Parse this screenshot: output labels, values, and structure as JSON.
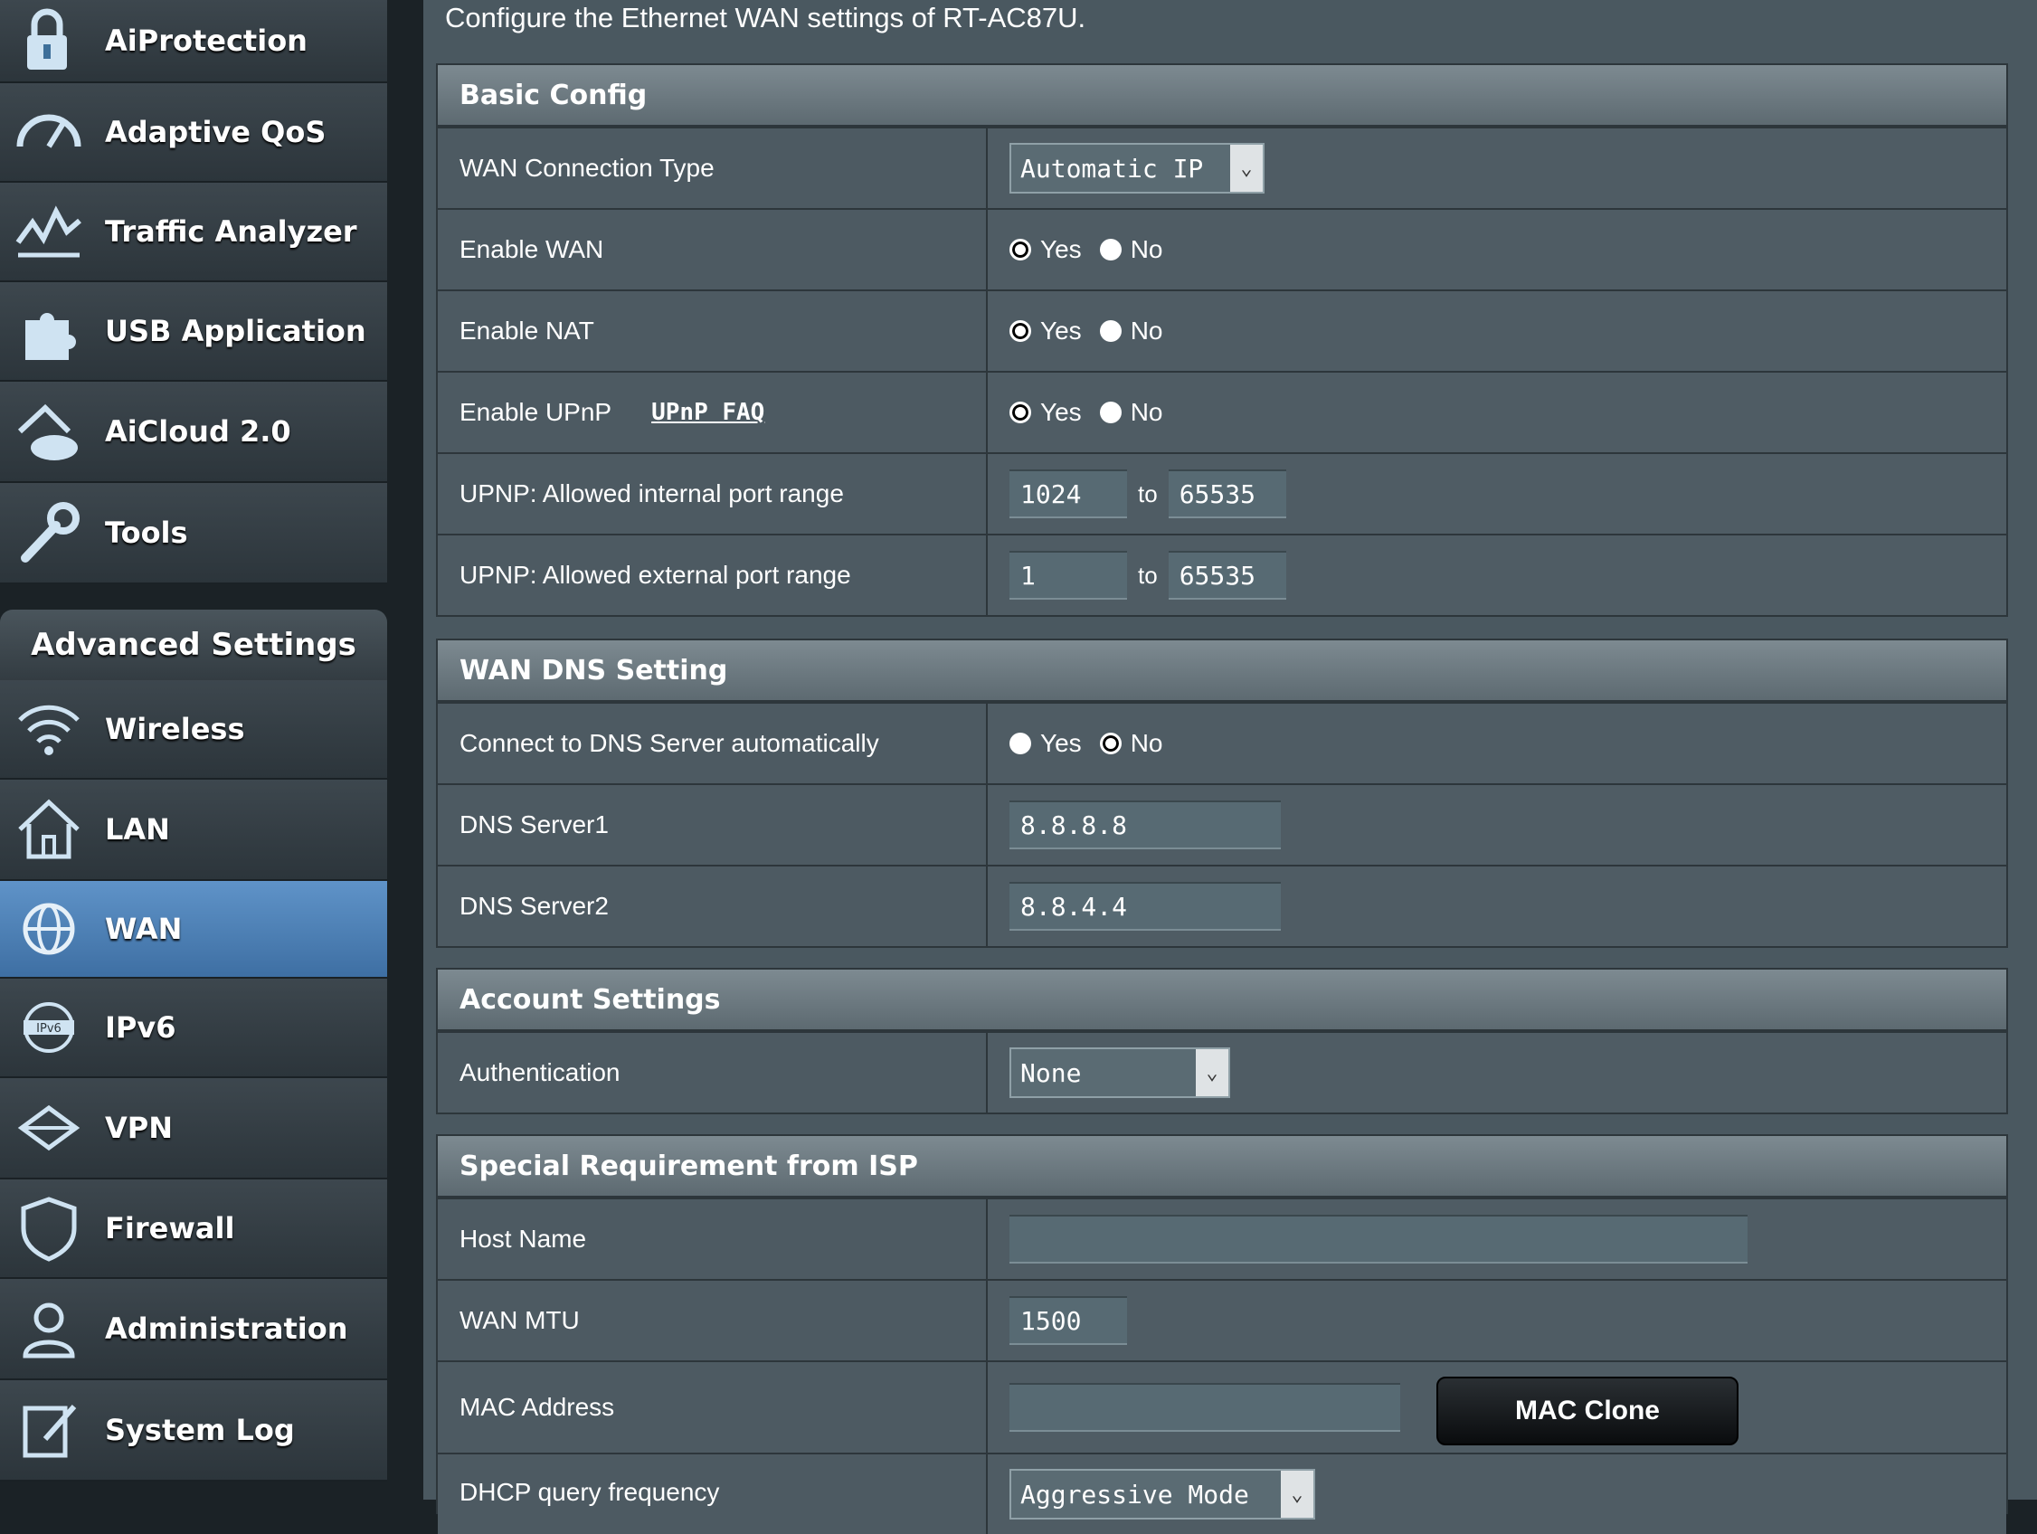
{
  "sidebar": {
    "general_items": [
      {
        "label": "AiProtection",
        "icon": "lock-icon"
      },
      {
        "label": "Adaptive QoS",
        "icon": "speedometer-icon"
      },
      {
        "label": "Traffic Analyzer",
        "icon": "activity-chart-icon"
      },
      {
        "label": "USB Application",
        "icon": "puzzle-icon"
      },
      {
        "label": "AiCloud 2.0",
        "icon": "cloud-house-icon"
      },
      {
        "label": "Tools",
        "icon": "wrench-icon"
      }
    ],
    "advanced_header": "Advanced Settings",
    "advanced_items": [
      {
        "label": "Wireless",
        "icon": "wifi-icon"
      },
      {
        "label": "LAN",
        "icon": "house-icon"
      },
      {
        "label": "WAN",
        "icon": "globe-icon",
        "selected": true
      },
      {
        "label": "IPv6",
        "icon": "ipv6-globe-icon"
      },
      {
        "label": "VPN",
        "icon": "vpn-icon"
      },
      {
        "label": "Firewall",
        "icon": "shield-icon"
      },
      {
        "label": "Administration",
        "icon": "user-icon"
      },
      {
        "label": "System Log",
        "icon": "edit-log-icon"
      }
    ]
  },
  "main": {
    "description": "Configure the Ethernet WAN settings of RT-AC87U.",
    "basic": {
      "title": "Basic Config",
      "wan_type_label": "WAN Connection Type",
      "wan_type_value": "Automatic IP",
      "enable_wan_label": "Enable WAN",
      "enable_nat_label": "Enable NAT",
      "enable_upnp_label": "Enable UPnP",
      "upnp_faq": "UPnP  FAQ",
      "upnp_int_label": "UPNP: Allowed internal port range",
      "upnp_int_from": "1024",
      "upnp_int_to": "65535",
      "upnp_ext_label": "UPNP: Allowed external port range",
      "upnp_ext_from": "1",
      "upnp_ext_to": "65535",
      "to": "to",
      "yes": "Yes",
      "no": "No"
    },
    "dns": {
      "title": "WAN DNS Setting",
      "auto_label": "Connect to DNS Server automatically",
      "server1_label": "DNS Server1",
      "server1_value": "8.8.8.8",
      "server2_label": "DNS Server2",
      "server2_value": "8.8.4.4"
    },
    "account": {
      "title": "Account Settings",
      "auth_label": "Authentication",
      "auth_value": "None"
    },
    "isp": {
      "title": "Special Requirement from ISP",
      "host_label": "Host Name",
      "host_value": "",
      "mtu_label": "WAN MTU",
      "mtu_value": "1500",
      "mac_label": "MAC Address",
      "mac_value": "",
      "mac_clone": "MAC Clone",
      "dhcp_label": "DHCP query frequency",
      "dhcp_value": "Aggressive Mode"
    }
  }
}
